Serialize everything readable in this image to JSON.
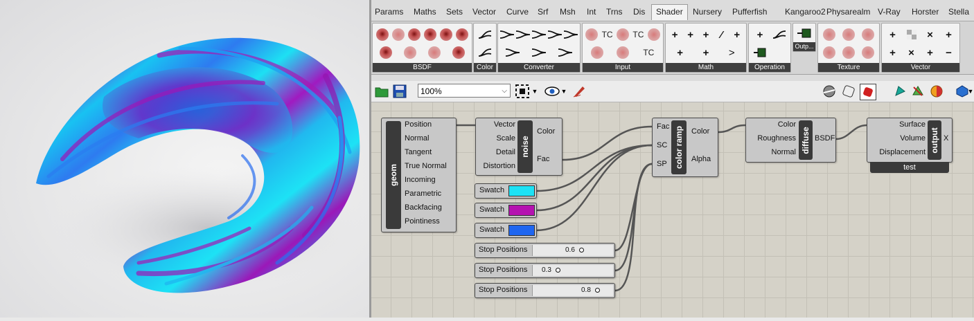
{
  "tabs": [
    "Params",
    "Maths",
    "Sets",
    "Vector",
    "Curve",
    "Srf",
    "Msh",
    "Int",
    "Trns",
    "Dis",
    "Shader",
    "Nursery",
    "Pufferfish",
    "Kangaroo2",
    "Physarealm",
    "V-Ray",
    "Horster",
    "Stella"
  ],
  "active_tab": "Shader",
  "ribbon_groups": {
    "bsdf": "BSDF",
    "color": "Color",
    "converter": "Converter",
    "input": "Input",
    "math": "Math",
    "operation": "Operation",
    "output_short": "Outp...",
    "texture": "Texture",
    "vector": "Vector",
    "tc": "TC"
  },
  "toolbar": {
    "zoom": "100%"
  },
  "nodes": {
    "geom": {
      "title": "geom",
      "outputs": [
        "Position",
        "Normal",
        "Tangent",
        "True Normal",
        "Incoming",
        "Parametric",
        "Backfacing",
        "Pointiness"
      ]
    },
    "noise": {
      "title": "noise",
      "inputs": [
        "Vector",
        "Scale",
        "Detail",
        "Distortion"
      ],
      "outputs": [
        "Color",
        "Fac"
      ]
    },
    "color_ramp": {
      "title": "color ramp",
      "inputs": [
        "Fac",
        "SC",
        "SP"
      ],
      "outputs": [
        "Color",
        "Alpha"
      ]
    },
    "diffuse": {
      "title": "diffuse",
      "inputs": [
        "Color",
        "Roughness",
        "Normal"
      ],
      "outputs": [
        "BSDF"
      ]
    },
    "output": {
      "title": "output",
      "inputs": [
        "Surface",
        "Volume",
        "Displacement"
      ],
      "outputs": [
        "X"
      ],
      "tag": "test"
    },
    "swatches": [
      {
        "label": "Swatch",
        "color": "#1de2f5"
      },
      {
        "label": "Swatch",
        "color": "#b512b0"
      },
      {
        "label": "Swatch",
        "color": "#1f66f0"
      }
    ],
    "sliders": [
      {
        "label": "Stop Positions",
        "value": "0.6",
        "fraction": 0.6
      },
      {
        "label": "Stop Positions",
        "value": "0.3",
        "fraction": 0.3
      },
      {
        "label": "Stop Positions",
        "value": "0.8",
        "fraction": 0.8
      }
    ]
  },
  "colors": {
    "cyan": "#1de2f5",
    "magenta": "#b512b0",
    "blue": "#1f66f0"
  }
}
